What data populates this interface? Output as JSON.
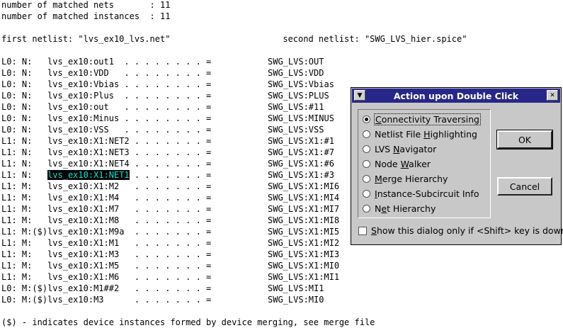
{
  "report": {
    "header_lines": [
      "number of matched nets       : 11",
      "number of matched instances  : 11"
    ],
    "netlists_line": "first netlist: \"lvs_ex10_lvs.net\"                      second netlist: \"SWG_LVS_hier.spice\"",
    "rows": [
      {
        "level": "L0:",
        "type": "N:",
        "mark": "",
        "left": "lvs_ex10:out1",
        "dots": "  . . . . . . . . =",
        "right": "SWG_LVS:OUT"
      },
      {
        "level": "L0:",
        "type": "N:",
        "mark": "",
        "left": "lvs_ex10:VDD",
        "dots": "   . . . . . . . . =",
        "right": "SWG_LVS:VDD"
      },
      {
        "level": "L0:",
        "type": "N:",
        "mark": "",
        "left": "lvs_ex10:Vbias",
        "dots": " . . . . . . . . =",
        "right": "SWG_LVS:Vbias"
      },
      {
        "level": "L0:",
        "type": "N:",
        "mark": "",
        "left": "lvs_ex10:Plus",
        "dots": "  . . . . . . . . =",
        "right": "SWG_LVS:PLUS"
      },
      {
        "level": "L0:",
        "type": "N:",
        "mark": "",
        "left": "lvs_ex10:out",
        "dots": "   . . . . . . . . =",
        "right": "SWG_LVS:#11"
      },
      {
        "level": "L0:",
        "type": "N:",
        "mark": "",
        "left": "lvs_ex10:Minus",
        "dots": " . . . . . . . . =",
        "right": "SWG_LVS:MINUS"
      },
      {
        "level": "L0:",
        "type": "N:",
        "mark": "",
        "left": "lvs_ex10:VSS",
        "dots": "   . . . . . . . . =",
        "right": "SWG_LVS:VSS"
      },
      {
        "level": "L1:",
        "type": "N:",
        "mark": "",
        "left": "lvs_ex10:X1:NET2",
        "dots": " . . . . . . . =",
        "right": "SWG_LVS:X1:#1"
      },
      {
        "level": "L1:",
        "type": "N:",
        "mark": "",
        "left": "lvs_ex10:X1:NET3",
        "dots": " . . . . . . . =",
        "right": "SWG_LVS:X1:#7"
      },
      {
        "level": "L1:",
        "type": "N:",
        "mark": "",
        "left": "lvs_ex10:X1:NET4",
        "dots": " . . . . . . . =",
        "right": "SWG_LVS:X1:#6"
      },
      {
        "level": "L1:",
        "type": "N:",
        "mark": "",
        "left": "lvs_ex10:X1:NET1",
        "dots": " . . . . . . . =",
        "right": "SWG_LVS:X1:#3",
        "highlight": true
      },
      {
        "level": "L1:",
        "type": "M:",
        "mark": "",
        "left": "lvs_ex10:X1:M2",
        "dots": "   . . . . . . . =",
        "right": "SWG_LVS:X1:MI6"
      },
      {
        "level": "L1:",
        "type": "M:",
        "mark": "",
        "left": "lvs_ex10:X1:M4",
        "dots": "   . . . . . . . =",
        "right": "SWG_LVS:X1:MI4"
      },
      {
        "level": "L1:",
        "type": "M:",
        "mark": "",
        "left": "lvs_ex10:X1:M7",
        "dots": "   . . . . . . . =",
        "right": "SWG_LVS:X1:MI7"
      },
      {
        "level": "L1:",
        "type": "M:",
        "mark": "",
        "left": "lvs_ex10:X1:M8",
        "dots": "   . . . . . . . =",
        "right": "SWG_LVS:X1:MI8"
      },
      {
        "level": "L1:",
        "type": "M:",
        "mark": "($)",
        "left": "lvs_ex10:X1:M9a",
        "dots": "  . . . . . . . =",
        "right": "SWG_LVS:X1:MI5"
      },
      {
        "level": "L1:",
        "type": "M:",
        "mark": "",
        "left": "lvs_ex10:X1:M1",
        "dots": "   . . . . . . . =",
        "right": "SWG_LVS:X1:MI2"
      },
      {
        "level": "L1:",
        "type": "M:",
        "mark": "",
        "left": "lvs_ex10:X1:M3",
        "dots": "   . . . . . . . =",
        "right": "SWG_LVS:X1:MI3"
      },
      {
        "level": "L1:",
        "type": "M:",
        "mark": "",
        "left": "lvs_ex10:X1:M5",
        "dots": "   . . . . . . . =",
        "right": "SWG_LVS:X1:MI0"
      },
      {
        "level": "L1:",
        "type": "M:",
        "mark": "",
        "left": "lvs_ex10:X1:M6",
        "dots": "   . . . . . . . =",
        "right": "SWG_LVS:X1:MI1"
      },
      {
        "level": "L0:",
        "type": "M:",
        "mark": "($)",
        "left": "lvs_ex10:M1##2",
        "dots": "   . . . . . . . =",
        "right": "SWG_LVS:MI1"
      },
      {
        "level": "L0:",
        "type": "M:",
        "mark": "($)",
        "left": "lvs_ex10:M3",
        "dots": "      . . . . . . . =",
        "right": "SWG_LVS:MI0"
      }
    ],
    "footer": "($) - indicates device instances formed by device merging, see merge file"
  },
  "dialog": {
    "title": "Action upon Double Click",
    "options": [
      {
        "pre": "",
        "key": "C",
        "post": "onnectivity Traversing",
        "selected": true
      },
      {
        "pre": "Netlist File ",
        "key": "H",
        "post": "ighlighting",
        "selected": false
      },
      {
        "pre": "LVS ",
        "key": "N",
        "post": "avigator",
        "selected": false
      },
      {
        "pre": "Node ",
        "key": "W",
        "post": "alker",
        "selected": false
      },
      {
        "pre": "",
        "key": "M",
        "post": "erge Hierarchy",
        "selected": false
      },
      {
        "pre": "",
        "key": "I",
        "post": "nstance-Subcircuit Info",
        "selected": false
      },
      {
        "pre": "N",
        "key": "e",
        "post": "t Hierarchy",
        "selected": false
      }
    ],
    "ok_label": "OK",
    "cancel_label": "Cancel",
    "checkbox": {
      "pre": "",
      "key": "S",
      "post": "how this dialog only if <Shift> key is down",
      "checked": false
    }
  }
}
